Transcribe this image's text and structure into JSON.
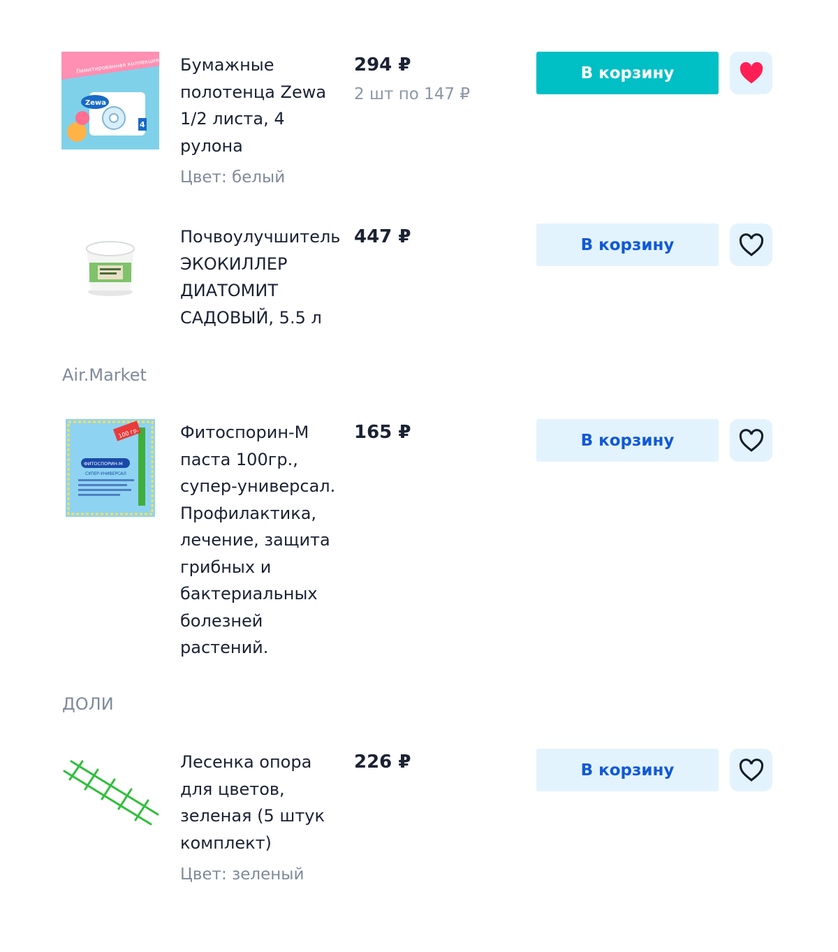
{
  "products": [
    {
      "title": "Бумажные полотенца Zewa 1/2 листа, 4 рулона",
      "price": "294 ₽",
      "unit_price": "2 шт по 147 ₽",
      "color": "Цвет: белый",
      "cart_label": "В корзину",
      "favorited": true,
      "thumb_label": "Zewa",
      "thumb_banner": "Лимитированная коллекция",
      "thumb_count": "4"
    },
    {
      "title": "Почвоулучшитель ЭКОКИЛЛЕР ДИАТОМИТ САДОВЫЙ, 5.5 л",
      "price": "447 ₽",
      "cart_label": "В корзину",
      "favorited": false
    },
    {
      "title": "Фитоспорин-М паста 100гр., супер-универсал. Профилактика, лечение, защита грибных и бактериальных болезней растений.",
      "price": "165 ₽",
      "cart_label": "В корзину",
      "favorited": false,
      "thumb_label": "ФИТОСПОРИН-М",
      "thumb_weight": "100 гр.",
      "thumb_sub": "СУПЕР-УНИВЕРСАЛ"
    },
    {
      "title": "Лесенка опора для цветов, зеленая (5 штук комплект)",
      "price": "226 ₽",
      "color": "Цвет: зеленый",
      "cart_label": "В корзину",
      "favorited": false
    }
  ],
  "sellers": [
    "Air.Market",
    "ДОЛИ"
  ],
  "colors": {
    "primary_button": "#00bfc5",
    "secondary_button_bg": "#e3f3fd",
    "secondary_button_text": "#1059d8",
    "favorite_active": "#ff1f55",
    "text_main": "#1a2233",
    "text_muted": "#7e8a9a"
  },
  "icons": {
    "favorite_filled": "heart-filled-icon",
    "favorite_outline": "heart-outline-icon"
  }
}
